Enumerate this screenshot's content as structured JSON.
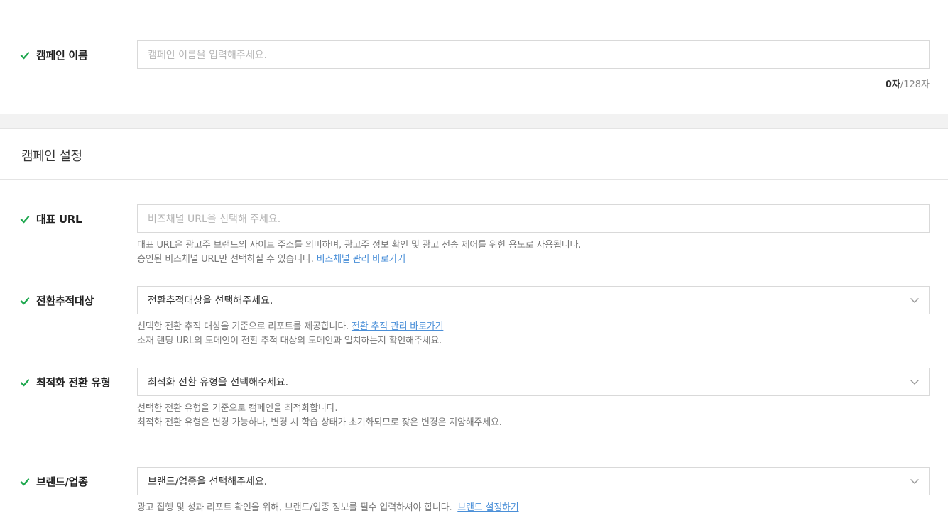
{
  "campaign_name": {
    "label": "캠페인 이름",
    "placeholder": "캠페인 이름을 입력해주세요.",
    "count_current": "0자",
    "count_separator": "/",
    "count_max": "128자"
  },
  "settings": {
    "title": "캠페인 설정",
    "rep_url": {
      "label": "대표 URL",
      "placeholder": "비즈채널 URL을 선택해 주세요.",
      "help_line1": "대표 URL은 광고주 브랜드의 사이트 주소를 의미하며, 광고주 정보 확인 및 광고 전송 제어를 위한 용도로 사용됩니다.",
      "help_line2": "승인된 비즈채널 URL만 선택하실 수 있습니다.",
      "help_link": "비즈채널 관리 바로가기"
    },
    "conversion_target": {
      "label": "전환추적대상",
      "value": "전환추적대상을 선택해주세요.",
      "help_line1": "선택한 전환 추적 대상을 기준으로 리포트를 제공합니다.",
      "help_link": "전환 추적 관리 바로가기",
      "help_line2": "소재 랜딩 URL의 도메인이 전환 추적 대상의 도메인과 일치하는지 확인해주세요."
    },
    "optimization_type": {
      "label": "최적화 전환 유형",
      "value": "최적화 전환 유형을 선택해주세요.",
      "help_line1": "선택한 전환 유형을 기준으로 캠페인을 최적화합니다.",
      "help_line2": "최적화 전환 유형은 변경 가능하나, 변경 시 학습 상태가 초기화되므로 잦은 변경은 지양해주세요."
    },
    "brand_industry": {
      "label": "브랜드/업종",
      "value": "브랜드/업종을 선택해주세요.",
      "help_line1": "광고 집행 및 성과 리포트 확인을 위해, 브랜드/업종 정보를 필수 입력하셔야 합니다.",
      "help_link": "브랜드 설정하기"
    }
  },
  "colors": {
    "check": "#1fa84f",
    "link": "#4a8fd8"
  }
}
